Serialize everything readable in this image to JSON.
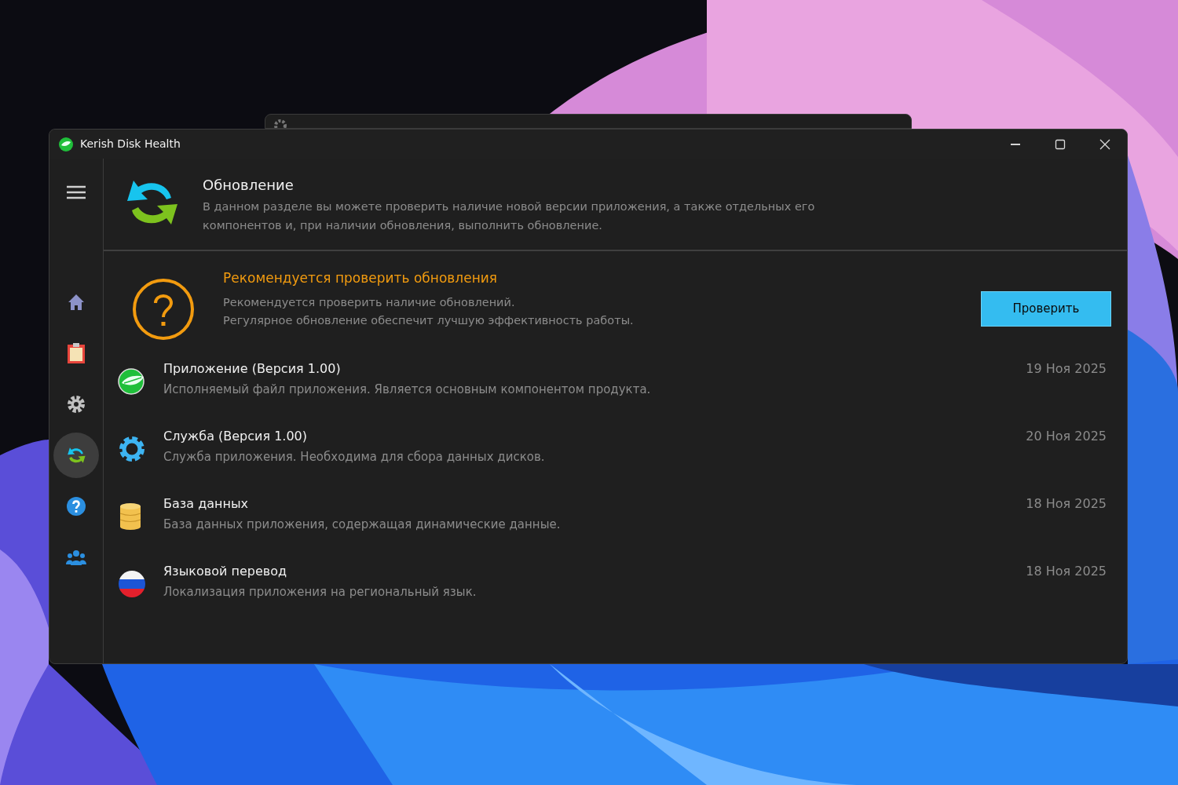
{
  "window": {
    "title": "Kerish Disk Health"
  },
  "sidebar": {
    "items": [
      {
        "kind": "home",
        "selected": false
      },
      {
        "kind": "report",
        "selected": false
      },
      {
        "kind": "settings",
        "selected": false
      },
      {
        "kind": "update",
        "selected": true
      },
      {
        "kind": "help",
        "selected": false
      },
      {
        "kind": "community",
        "selected": false
      }
    ]
  },
  "header": {
    "title": "Обновление",
    "description": "В данном разделе вы можете проверить наличие новой версии приложения, а также отдельных его компонентов и, при наличии обновления, выполнить обновление."
  },
  "notice": {
    "title": "Рекомендуется проверить обновления",
    "lines": [
      "Рекомендуется проверить наличие обновлений.",
      "Регулярное обновление обеспечит лучшую эффективность работы."
    ],
    "button": "Проверить"
  },
  "components": [
    {
      "kind": "app",
      "name": "Приложение (Версия 1.00)",
      "description": "Исполняемый файл приложения. Является основным компонентом продукта.",
      "date": "19 Ноя 2025"
    },
    {
      "kind": "service",
      "name": "Служба (Версия 1.00)",
      "description": "Служба приложения. Необходима для сбора данных дисков.",
      "date": "20 Ноя 2025"
    },
    {
      "kind": "database",
      "name": "База данных",
      "description": "База данных приложения, содержащая динамические данные.",
      "date": "18 Ноя 2025"
    },
    {
      "kind": "language",
      "name": "Языковой перевод",
      "description": "Локализация приложения на региональный язык.",
      "date": "18 Ноя 2025"
    }
  ]
}
